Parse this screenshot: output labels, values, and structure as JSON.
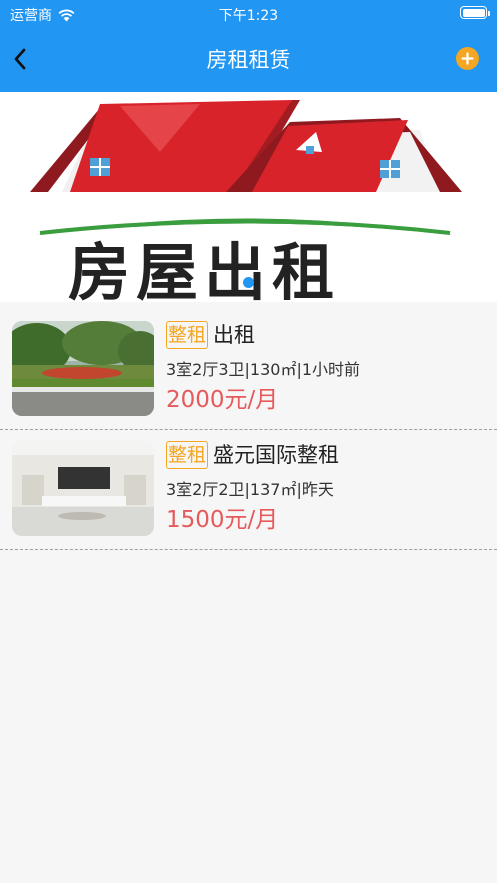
{
  "status_bar": {
    "carrier": "运营商",
    "time": "下午1:23"
  },
  "nav": {
    "title": "房租租赁"
  },
  "banner": {
    "text": "房屋出租"
  },
  "listings": [
    {
      "tag": "整租",
      "title": "出租",
      "meta": "3室2厅3卫|130㎡|1小时前",
      "price": "2000元/月"
    },
    {
      "tag": "整租",
      "title": "盛元国际整租",
      "meta": "3室2厅2卫|137㎡|昨天",
      "price": "1500元/月"
    }
  ],
  "colors": {
    "header": "#2196f3",
    "accent": "#f5a623",
    "price": "#e55a5a"
  }
}
